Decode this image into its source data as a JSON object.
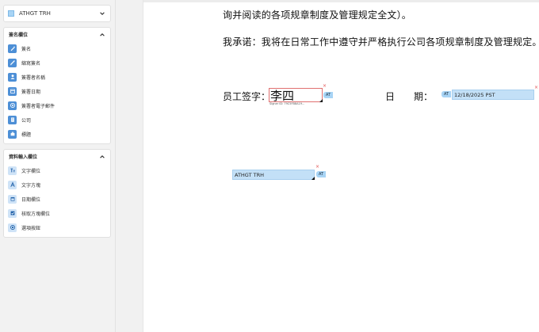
{
  "recipient": {
    "name": "ATHGT TRH",
    "color": "#a8d4f5"
  },
  "sign_fields": {
    "title": "簽名欄位",
    "items": [
      {
        "label": "簽名",
        "icon": "pen-icon"
      },
      {
        "label": "縮寫簽名",
        "icon": "pencil-icon"
      },
      {
        "label": "簽署者名稱",
        "icon": "person-icon"
      },
      {
        "label": "簽署日期",
        "icon": "calendar-icon"
      },
      {
        "label": "簽署者電子郵件",
        "icon": "at-icon"
      },
      {
        "label": "公司",
        "icon": "building-icon"
      },
      {
        "label": "標題",
        "icon": "briefcase-icon"
      }
    ]
  },
  "input_fields": {
    "title": "資料輸入欄位",
    "items": [
      {
        "label": "文字欄位",
        "icon": "text-field-icon"
      },
      {
        "label": "文字方塊",
        "icon": "text-box-icon"
      },
      {
        "label": "日期欄位",
        "icon": "date-field-icon"
      },
      {
        "label": "核取方塊欄位",
        "icon": "checkbox-icon"
      },
      {
        "label": "選項按鈕",
        "icon": "radio-icon"
      }
    ]
  },
  "document": {
    "line1": "询并阅读的各项规章制度及管理规定全文）。",
    "line2": "我承诺：我将在日常工作中遵守并严格执行公司各项规章制度及管理规定。",
    "sign_label": "员工签字：",
    "date_label_a": "日",
    "date_label_b": "期：",
    "signature_value": "李四",
    "signature_id": "Signer ID: 79C5FB8A19...",
    "date_value": "12/18/2025 PST",
    "text_field_value": "ATHGT TRH",
    "at_badge": "AT",
    "close_glyph": "×"
  }
}
